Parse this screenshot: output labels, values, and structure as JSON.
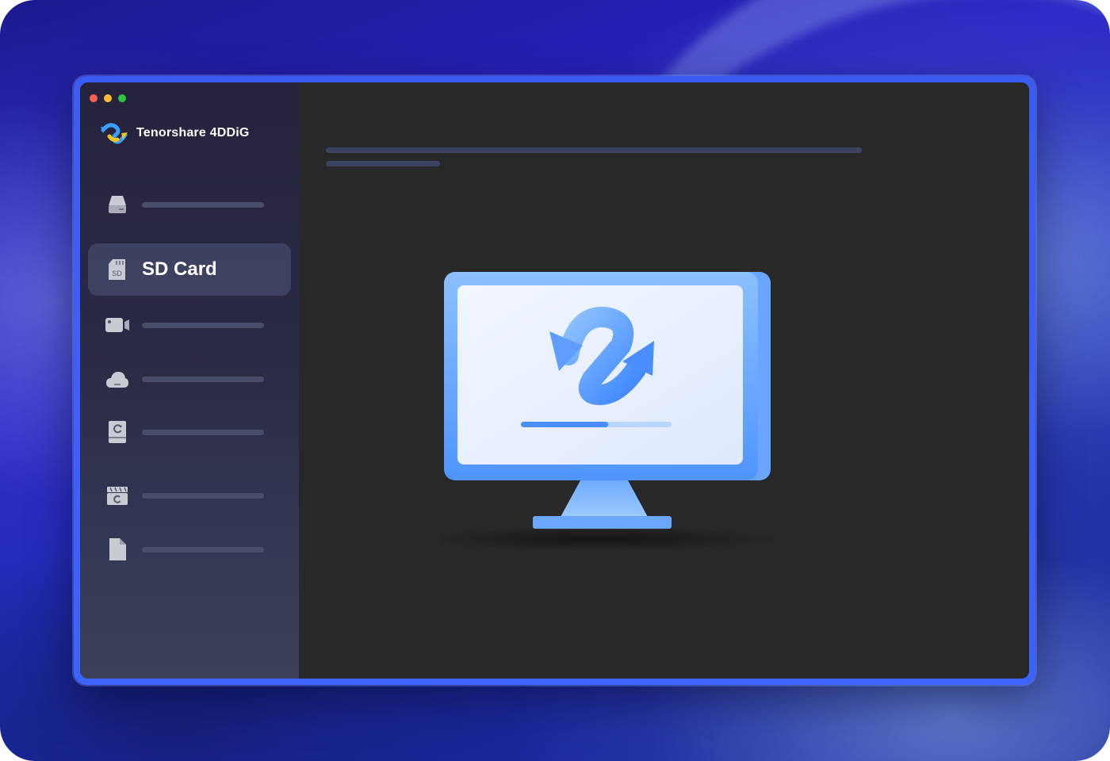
{
  "window": {
    "traffic_lights": [
      {
        "name": "close",
        "color": "#ff5f57"
      },
      {
        "name": "minimize",
        "color": "#febc2e"
      },
      {
        "name": "zoom",
        "color": "#28c840"
      }
    ]
  },
  "app": {
    "name": "Tenorshare 4DDiG",
    "logo_icon": "4ddig-logo-icon"
  },
  "sidebar": {
    "items": [
      {
        "icon": "hard-drive-icon",
        "label": ""
      },
      {
        "icon": "sd-card-icon",
        "label": "SD Card",
        "active": true
      },
      {
        "icon": "video-camera-icon",
        "label": ""
      },
      {
        "icon": "cloud-icon",
        "label": ""
      },
      {
        "icon": "recovery-drive-icon",
        "label": ""
      },
      {
        "icon": "clapperboard-icon",
        "label": ""
      },
      {
        "icon": "document-icon",
        "label": ""
      }
    ]
  },
  "main": {
    "illustration_icon": "monitor-sync-icon",
    "progress": 0.58
  },
  "colors": {
    "accent": "#3d63ff",
    "sidebar_bg": "#2b2a45",
    "main_bg": "#282828",
    "placeholder_bar": "#4a4d6a"
  }
}
